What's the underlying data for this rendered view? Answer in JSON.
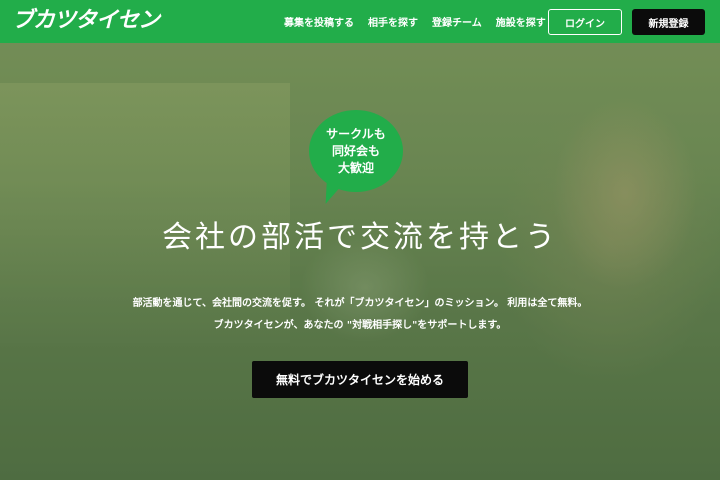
{
  "header": {
    "logo": "ブカツタイセン",
    "nav": [
      "募集を投稿する",
      "相手を探す",
      "登録チーム",
      "施設を探す"
    ],
    "login_label": "ログイン",
    "register_label": "新規登録"
  },
  "hero": {
    "bubble_lines": [
      "サークルも",
      "同好会も",
      "大歓迎"
    ],
    "title": "会社の部活で交流を持とう",
    "description_lines": [
      "部活動を通じて、会社間の交流を促す。 それが「ブカツタイセン」のミッション。 利用は全て無料。",
      "ブカツタイセンが、あなたの \"対戦相手探し\"をサポートします。"
    ],
    "cta_label": "無料でブカツタイセンを始める"
  },
  "colors": {
    "brand_green": "#22ad4a",
    "button_black": "#0b0b0b"
  }
}
